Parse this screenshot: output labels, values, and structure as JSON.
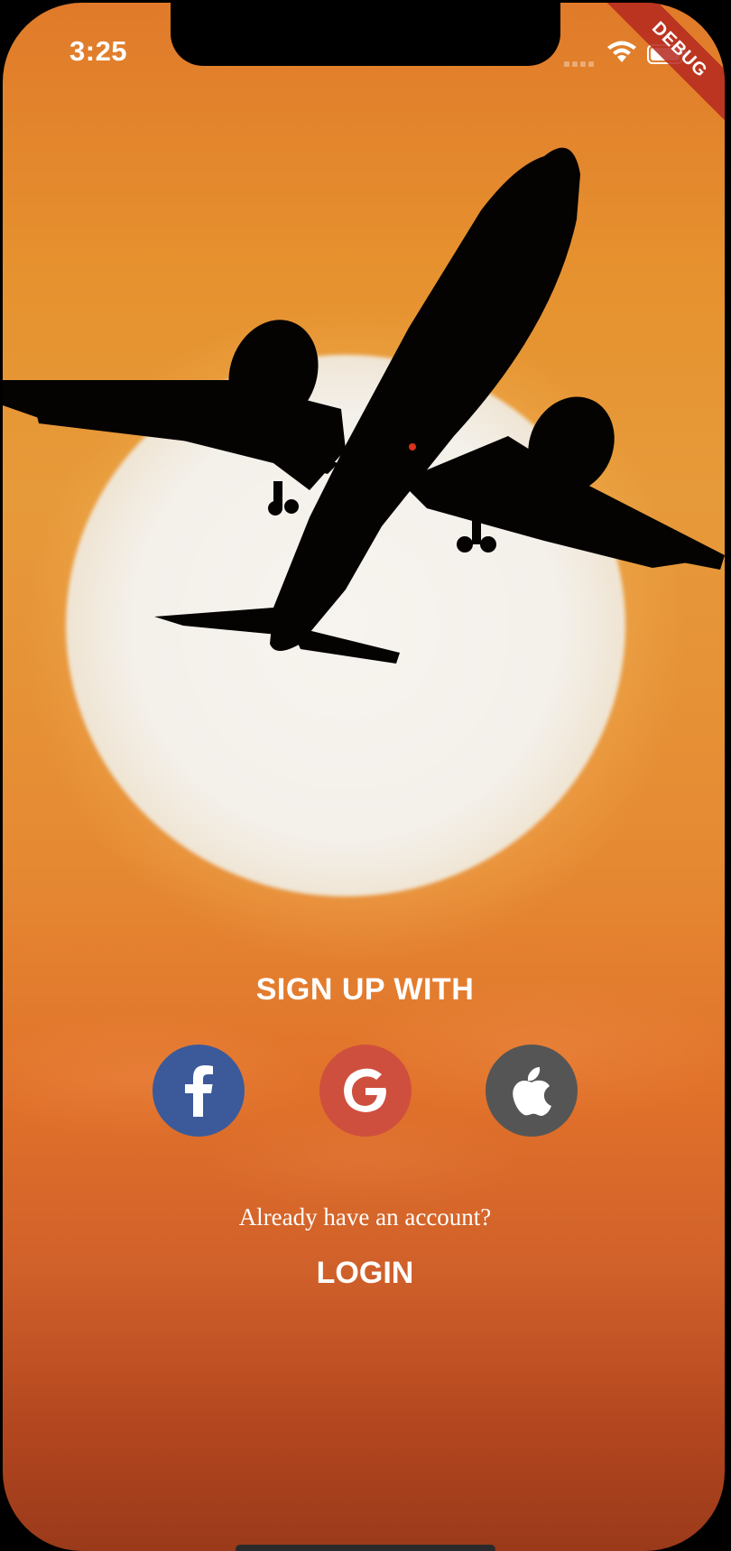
{
  "status_bar": {
    "time": "3:25",
    "debug_label": "DEBUG",
    "icons": [
      "signal-icon",
      "wifi-icon",
      "battery-icon"
    ]
  },
  "background": {
    "image": "airplane-silhouette-sunset",
    "colors": {
      "top": "#e07a2a",
      "middle": "#e79a3a",
      "bottom": "#9a3a1a",
      "sun": "#f4f0ea"
    }
  },
  "signup": {
    "title": "SIGN UP WITH",
    "providers": [
      {
        "name": "facebook",
        "icon": "facebook-icon",
        "color": "#3c5a9a"
      },
      {
        "name": "google",
        "icon": "google-icon",
        "color": "#cf4f3e"
      },
      {
        "name": "apple",
        "icon": "apple-icon",
        "color": "#555555"
      }
    ]
  },
  "login": {
    "prompt": "Already have an account?",
    "label": "LOGIN"
  }
}
